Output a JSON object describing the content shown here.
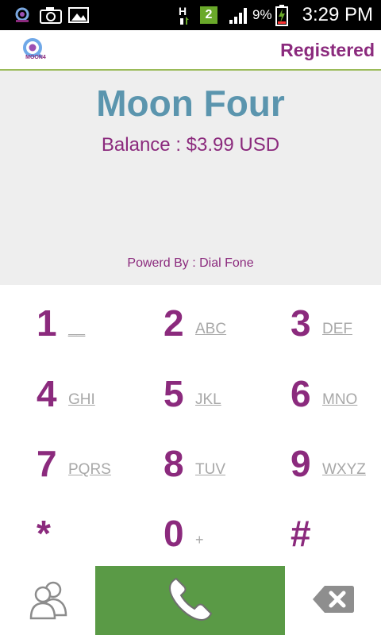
{
  "status_bar": {
    "battery_percent": "9%",
    "time": "3:29 PM",
    "network_type": "H",
    "notification_badge": "2",
    "icons": [
      "moon4-app-icon",
      "camera-icon",
      "gallery-icon",
      "network-h-icon",
      "notification-badge",
      "signal-icon",
      "battery-charging-icon"
    ]
  },
  "header": {
    "logo_text": "MOON4",
    "registration_status": "Registered"
  },
  "info": {
    "brand_name": "Moon Four",
    "balance": "Balance : $3.99 USD",
    "powered_by": "Powerd By : Dial Fone"
  },
  "keypad": {
    "keys": [
      {
        "digit": "1",
        "letters": "__"
      },
      {
        "digit": "2",
        "letters": "ABC"
      },
      {
        "digit": "3",
        "letters": "DEF"
      },
      {
        "digit": "4",
        "letters": "GHI"
      },
      {
        "digit": "5",
        "letters": "JKL"
      },
      {
        "digit": "6",
        "letters": "MNO"
      },
      {
        "digit": "7",
        "letters": "PQRS"
      },
      {
        "digit": "8",
        "letters": "TUV"
      },
      {
        "digit": "9",
        "letters": "WXYZ"
      },
      {
        "digit": "*",
        "letters": ""
      },
      {
        "digit": "0",
        "letters": "+"
      },
      {
        "digit": "#",
        "letters": ""
      }
    ]
  },
  "bottom_bar": {
    "icons": [
      "contacts-icon",
      "phone-handset-icon",
      "backspace-icon"
    ]
  },
  "colors": {
    "accent_purple": "#8b2a7d",
    "brand_blue": "#5b95ae",
    "call_green": "#5a9a46",
    "header_line": "#9bbb59",
    "panel_gray": "#eeeeee"
  }
}
